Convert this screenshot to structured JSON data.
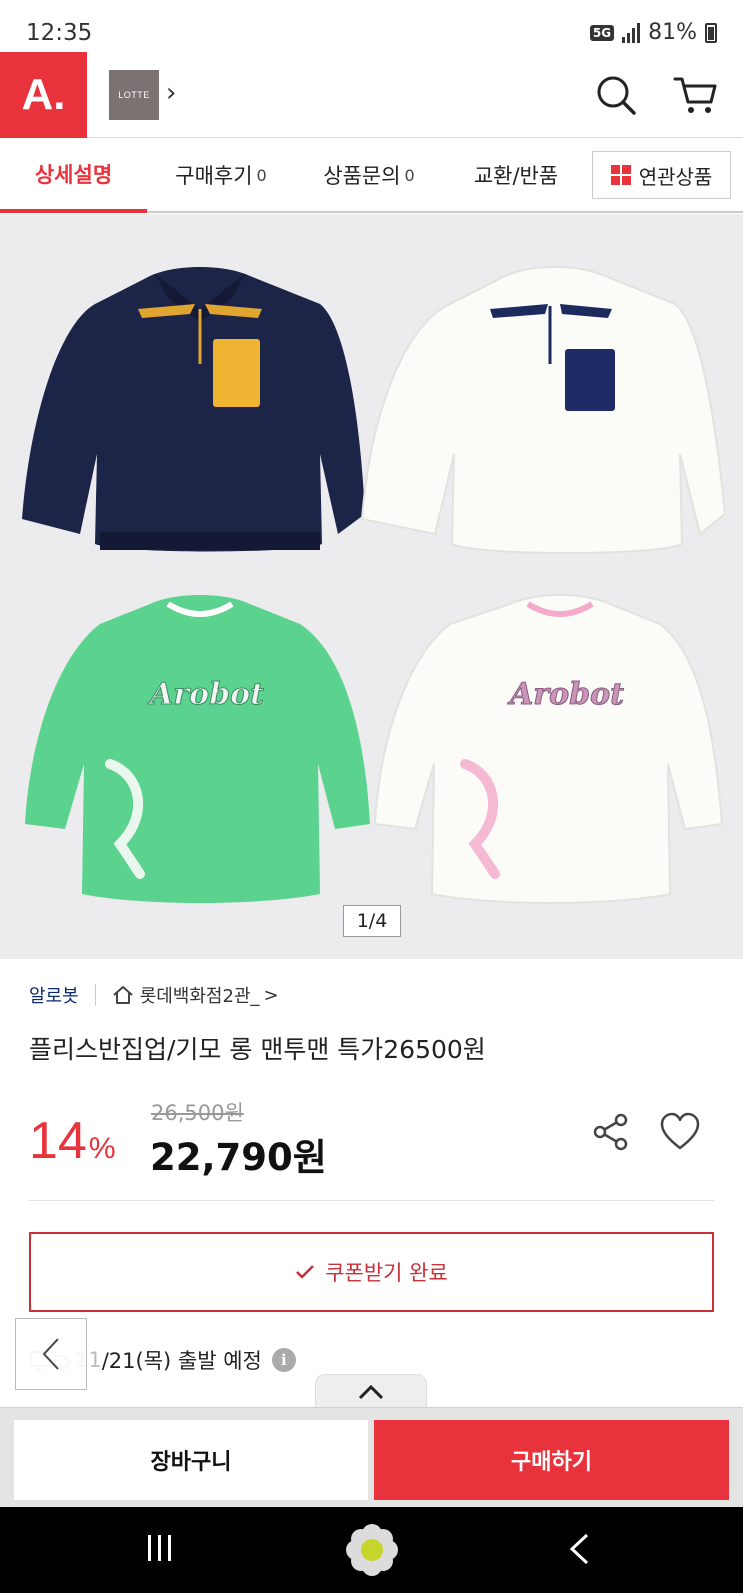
{
  "status_bar": {
    "time": "12:35",
    "network": "5G",
    "battery": "81%"
  },
  "header": {
    "logo_text": "A.",
    "mall_logo_text": "LOTTE",
    "mall_chevron": "›",
    "icons": [
      "search-icon",
      "cart-icon"
    ],
    "accent_color": "#e8323c"
  },
  "tabs": [
    {
      "label": "상세설명",
      "count": "",
      "active": true
    },
    {
      "label": "구매후기",
      "count": "0",
      "active": false
    },
    {
      "label": "상품문의",
      "count": "0",
      "active": false
    },
    {
      "label": "교환/반품",
      "count": "",
      "active": false
    }
  ],
  "related_tab": {
    "label": "연관상품"
  },
  "gallery": {
    "counter": "1/4",
    "print_text": "Arobot"
  },
  "product": {
    "brand": "알로봇",
    "store": "롯데백화점2관_",
    "store_chevron": ">",
    "title": "플리스반집업/기모 롱 맨투맨  특가26500원",
    "original_price": "26,500원",
    "discount_value": "14",
    "discount_unit": "%",
    "price": "22,790원"
  },
  "coupon": {
    "label": "쿠폰받기 완료"
  },
  "shipping": {
    "date_prefix": "11",
    "date_text": "/21(목) 출발 예정",
    "info_glyph": "i"
  },
  "actions": {
    "cart_label": "장바구니",
    "buy_label": "구매하기"
  },
  "colors": {
    "accent": "#e8323c",
    "brand_text": "#0b2a6e",
    "coupon_border": "#c8313a"
  }
}
